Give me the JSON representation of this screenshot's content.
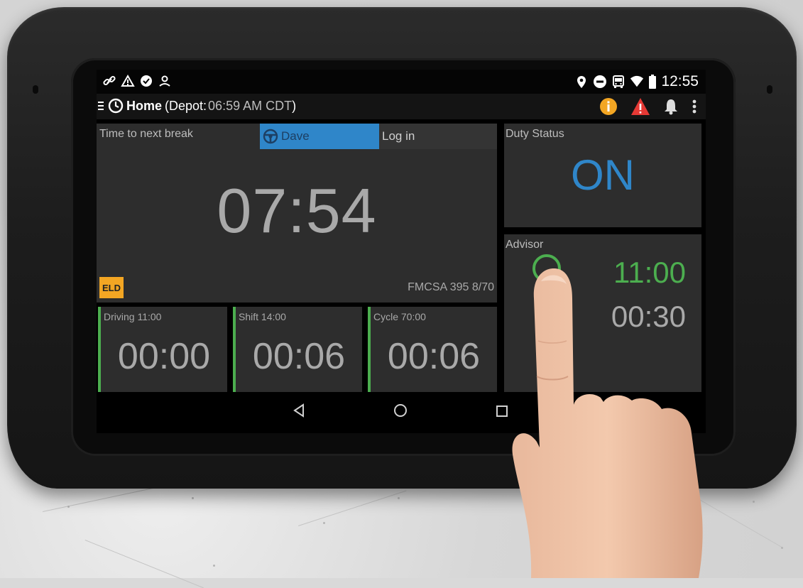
{
  "status_bar": {
    "left_icons": [
      "link-icon",
      "warning-icon",
      "check-circle-icon",
      "person-icon"
    ],
    "right_icons": [
      "location-pin-icon",
      "do-not-disturb-icon",
      "bus-icon",
      "wifi-icon",
      "battery-icon"
    ],
    "time": "12:55"
  },
  "app_bar": {
    "title": "Home",
    "depot_open": "(Depot:",
    "depot_time": "06:59 AM CDT",
    "depot_close": ")",
    "icons": [
      "info-icon",
      "alert-icon",
      "bell-icon",
      "more-vert-icon"
    ]
  },
  "main_panel": {
    "label": "Time to next break",
    "tabs": {
      "driver": "Dave",
      "login": "Log in"
    },
    "timer": "07:54",
    "badge": "ELD",
    "rule": "FMCSA 395 8/70"
  },
  "sub_panels": [
    {
      "label": "Driving 11:00",
      "value": "00:00"
    },
    {
      "label": "Shift 14:00",
      "value": "00:06"
    },
    {
      "label": "Cycle 70:00",
      "value": "00:06"
    }
  ],
  "duty_status": {
    "label": "Duty Status",
    "value": "ON"
  },
  "advisor": {
    "label": "Advisor",
    "primary": "11:00",
    "secondary": "00:30"
  },
  "nav": {
    "icons": [
      "back-icon",
      "home-icon",
      "recents-icon"
    ]
  },
  "colors": {
    "accent_blue": "#2f86c9",
    "accent_green": "#4cae4f",
    "eld_orange": "#f3a623",
    "alert_red": "#e53935",
    "info_amber": "#f3a623"
  }
}
